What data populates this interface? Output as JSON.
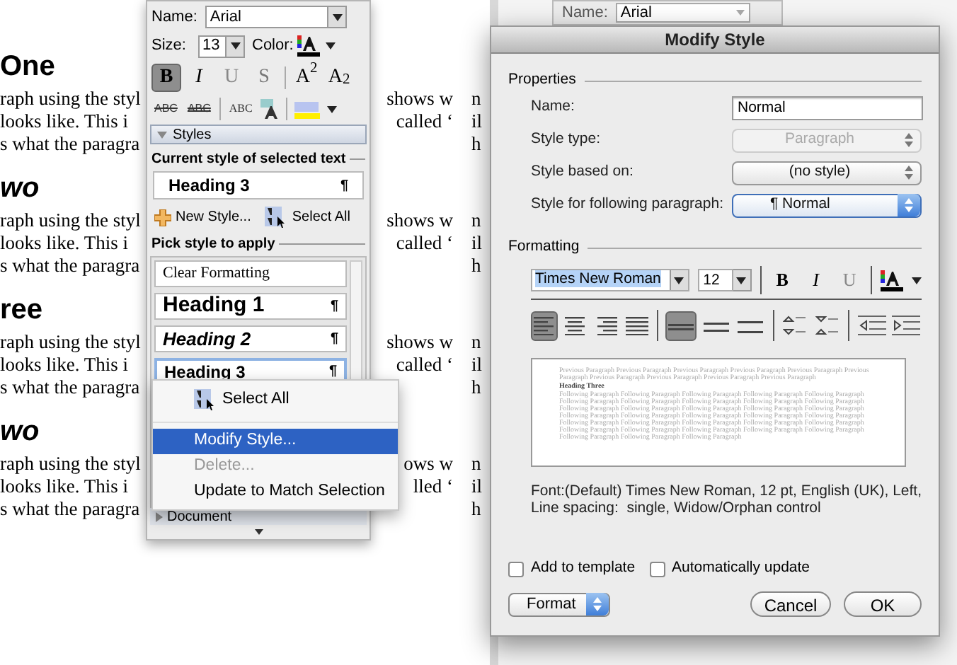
{
  "document": {
    "groups": [
      {
        "heading": "One",
        "kind": "bold",
        "lines": [
          {
            "left": "raph using the styl",
            "right": "shows w",
            "edge": "n"
          },
          {
            "left": "looks like. This i",
            "right": "called ‘",
            "edge": "il"
          },
          {
            "left": "s what the paragra",
            "edge": "h"
          }
        ]
      },
      {
        "heading": "wo",
        "kind": "bold_italic",
        "lines": [
          {
            "left": "raph using the styl",
            "right": "shows w",
            "edge": "n"
          },
          {
            "left": "looks like. This i",
            "right": "called ‘",
            "edge": "il"
          },
          {
            "left": "s what the paragra",
            "edge": "h"
          }
        ]
      },
      {
        "heading": "ree",
        "kind": "bold",
        "lines": [
          {
            "left": "raph using the styl",
            "right": "shows w",
            "edge": "n"
          },
          {
            "left": "looks like. This i",
            "right": "called ‘",
            "edge": "il"
          },
          {
            "left": "s what the paragra",
            "edge": "h"
          }
        ]
      },
      {
        "heading": "wo",
        "kind": "bold_italic",
        "lines": [
          {
            "left": "raph using the styl",
            "right": "ows w",
            "edge": "n"
          },
          {
            "left": "looks like. This i",
            "right": "lled ‘",
            "edge": "il"
          },
          {
            "left": "s what the paragra",
            "edge": "h"
          }
        ]
      }
    ]
  },
  "palette": {
    "name_label": "Name:",
    "font": "Arial",
    "size_label": "Size:",
    "size": "13",
    "color_label": "Color:",
    "format_buttons": [
      {
        "kind": "bold",
        "label": "B",
        "selected": true
      },
      {
        "kind": "italic",
        "label": "I",
        "selected": false
      },
      {
        "kind": "underline",
        "label": "U",
        "selected": false
      },
      {
        "kind": "shadow",
        "label": "S",
        "selected": false
      },
      {
        "kind": "superscript",
        "label": "A$^{2}$",
        "selected": false
      },
      {
        "kind": "subscript",
        "label": "A$_{2}$",
        "selected": false
      }
    ],
    "effect_buttons": [
      {
        "kind": "strikethrough",
        "label": "ABC"
      },
      {
        "kind": "double_strikethrough",
        "label": "ABC"
      },
      {
        "kind": "small_caps",
        "label": "ABC"
      }
    ],
    "styles_header": "Styles",
    "current_label": "Current style of selected text",
    "current_style": {
      "label": "Heading 3",
      "mark": "¶"
    },
    "new_style": "New Style...",
    "select_all": "Select All",
    "pick_label": "Pick style to apply",
    "styles": [
      {
        "kind": "clear",
        "label": "Clear Formatting",
        "selected": false
      },
      {
        "kind": "heading1",
        "label": "Heading 1",
        "mark": "¶",
        "selected": false
      },
      {
        "kind": "heading2",
        "label": "Heading 2",
        "mark": "¶",
        "selected": false
      },
      {
        "kind": "heading3",
        "label": "Heading 3",
        "mark": "¶",
        "selected": true
      }
    ],
    "document_section": "Document"
  },
  "context_menu": {
    "items": [
      {
        "kind": "icon",
        "label": "Select All",
        "selected": false,
        "disabled": false
      },
      {
        "kind": "separator"
      },
      {
        "kind": "plain",
        "label": "Modify Style...",
        "selected": true,
        "disabled": false
      },
      {
        "kind": "plain",
        "label": "Delete...",
        "selected": false,
        "disabled": true
      },
      {
        "kind": "plain",
        "label": "Update to Match Selection",
        "selected": false,
        "disabled": false
      }
    ]
  },
  "background_palette": {
    "name_label": "Name:",
    "font": "Arial"
  },
  "dialog": {
    "title": "Modify Style",
    "properties_label": "Properties",
    "fields": [
      {
        "kind": "text",
        "label": "Name:",
        "value": "Normal"
      },
      {
        "kind": "popup",
        "label": "Style type:",
        "value": "Paragraph",
        "disabled": true,
        "active": false
      },
      {
        "kind": "popup",
        "label": "Style based on:",
        "value": "(no style)",
        "disabled": false,
        "active": false
      },
      {
        "kind": "popup",
        "label": "Style for following paragraph:",
        "value": "¶ Normal",
        "disabled": false,
        "active": true
      }
    ],
    "formatting_label": "Formatting",
    "font": "Times New Roman",
    "size": "12",
    "style_buttons": [
      {
        "kind": "bold",
        "label": "B"
      },
      {
        "kind": "italic",
        "label": "I"
      },
      {
        "kind": "underline",
        "label": "U"
      }
    ],
    "alignment": [
      {
        "kind": "left",
        "selected": true
      },
      {
        "kind": "center",
        "selected": false
      },
      {
        "kind": "right",
        "selected": false
      },
      {
        "kind": "justify",
        "selected": false
      }
    ],
    "line_spacing": [
      {
        "kind": "single",
        "selected": true
      },
      {
        "kind": "one_half",
        "selected": false
      },
      {
        "kind": "double",
        "selected": false
      }
    ],
    "preview": {
      "previous": "Previous Paragraph Previous Paragraph Previous Paragraph Previous Paragraph Previous Paragraph Previous Paragraph Previous Paragraph Previous Paragraph Previous Paragraph Previous Paragraph",
      "heading": "Heading Three",
      "following": "Following Paragraph Following Paragraph Following Paragraph Following Paragraph Following Paragraph Following Paragraph Following Paragraph Following Paragraph Following Paragraph Following Paragraph Following Paragraph Following Paragraph Following Paragraph Following Paragraph Following Paragraph Following Paragraph Following Paragraph Following Paragraph Following Paragraph Following Paragraph Following Paragraph Following Paragraph Following Paragraph Following Paragraph Following Paragraph Following Paragraph Following Paragraph Following Paragraph Following Paragraph Following Paragraph Following Paragraph Following Paragraph Following Paragraph"
    },
    "description": "Font:(Default) Times New Roman, 12 pt, English (UK), Left, Line spacing:  single, Widow/Orphan control",
    "checkboxes": [
      {
        "label": "Add to template",
        "checked": false
      },
      {
        "label": "Automatically update",
        "checked": false
      }
    ],
    "format_button": "Format",
    "cancel": "Cancel",
    "ok": "OK"
  }
}
